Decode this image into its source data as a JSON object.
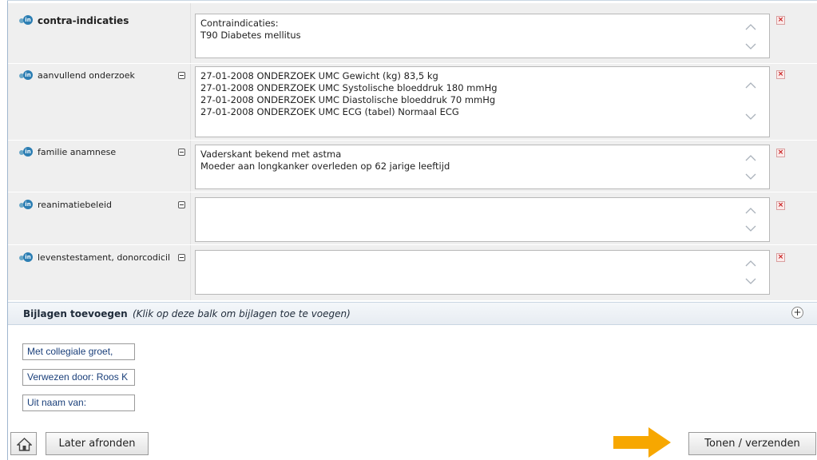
{
  "rows": [
    {
      "label": "contra-indicaties",
      "lines": [
        "Contraindicaties:",
        "T90 Diabetes mellitus"
      ]
    },
    {
      "label": "aanvullend onderzoek",
      "lines": [
        "27-01-2008 ONDERZOEK UMC Gewicht (kg) 83,5 kg",
        "27-01-2008 ONDERZOEK UMC Systolische bloeddruk 180 mmHg",
        "27-01-2008 ONDERZOEK UMC Diastolische bloeddruk  70 mmHg",
        "27-01-2008 ONDERZOEK UMC ECG (tabel) Normaal ECG"
      ]
    },
    {
      "label": "familie anamnese",
      "lines": [
        "Vaderskant bekend met astma",
        "Moeder aan longkanker overleden op 62 jarige leeftijd"
      ]
    },
    {
      "label": "reanimatiebeleid",
      "lines": []
    },
    {
      "label": "levenstestament, donorcodicil",
      "lines": []
    }
  ],
  "attachments": {
    "title": "Bijlagen toevoegen",
    "hint": "(Klik op deze balk om bijlagen toe te voegen)"
  },
  "signature": {
    "greeting": "Met collegiale groet,",
    "referred_by": "Verwezen door: Roos K",
    "on_behalf_of": "Uit naam van:"
  },
  "footer": {
    "later_label": "Later afronden",
    "send_label": "Tonen / verzenden"
  },
  "colors": {
    "accent_arrow": "#f7a700",
    "link_text": "#1a3f7a"
  },
  "icons": {
    "badge": "patient-info-badge-icon",
    "delete": "delete-icon",
    "home": "home-icon",
    "expand": "plus-icon"
  }
}
